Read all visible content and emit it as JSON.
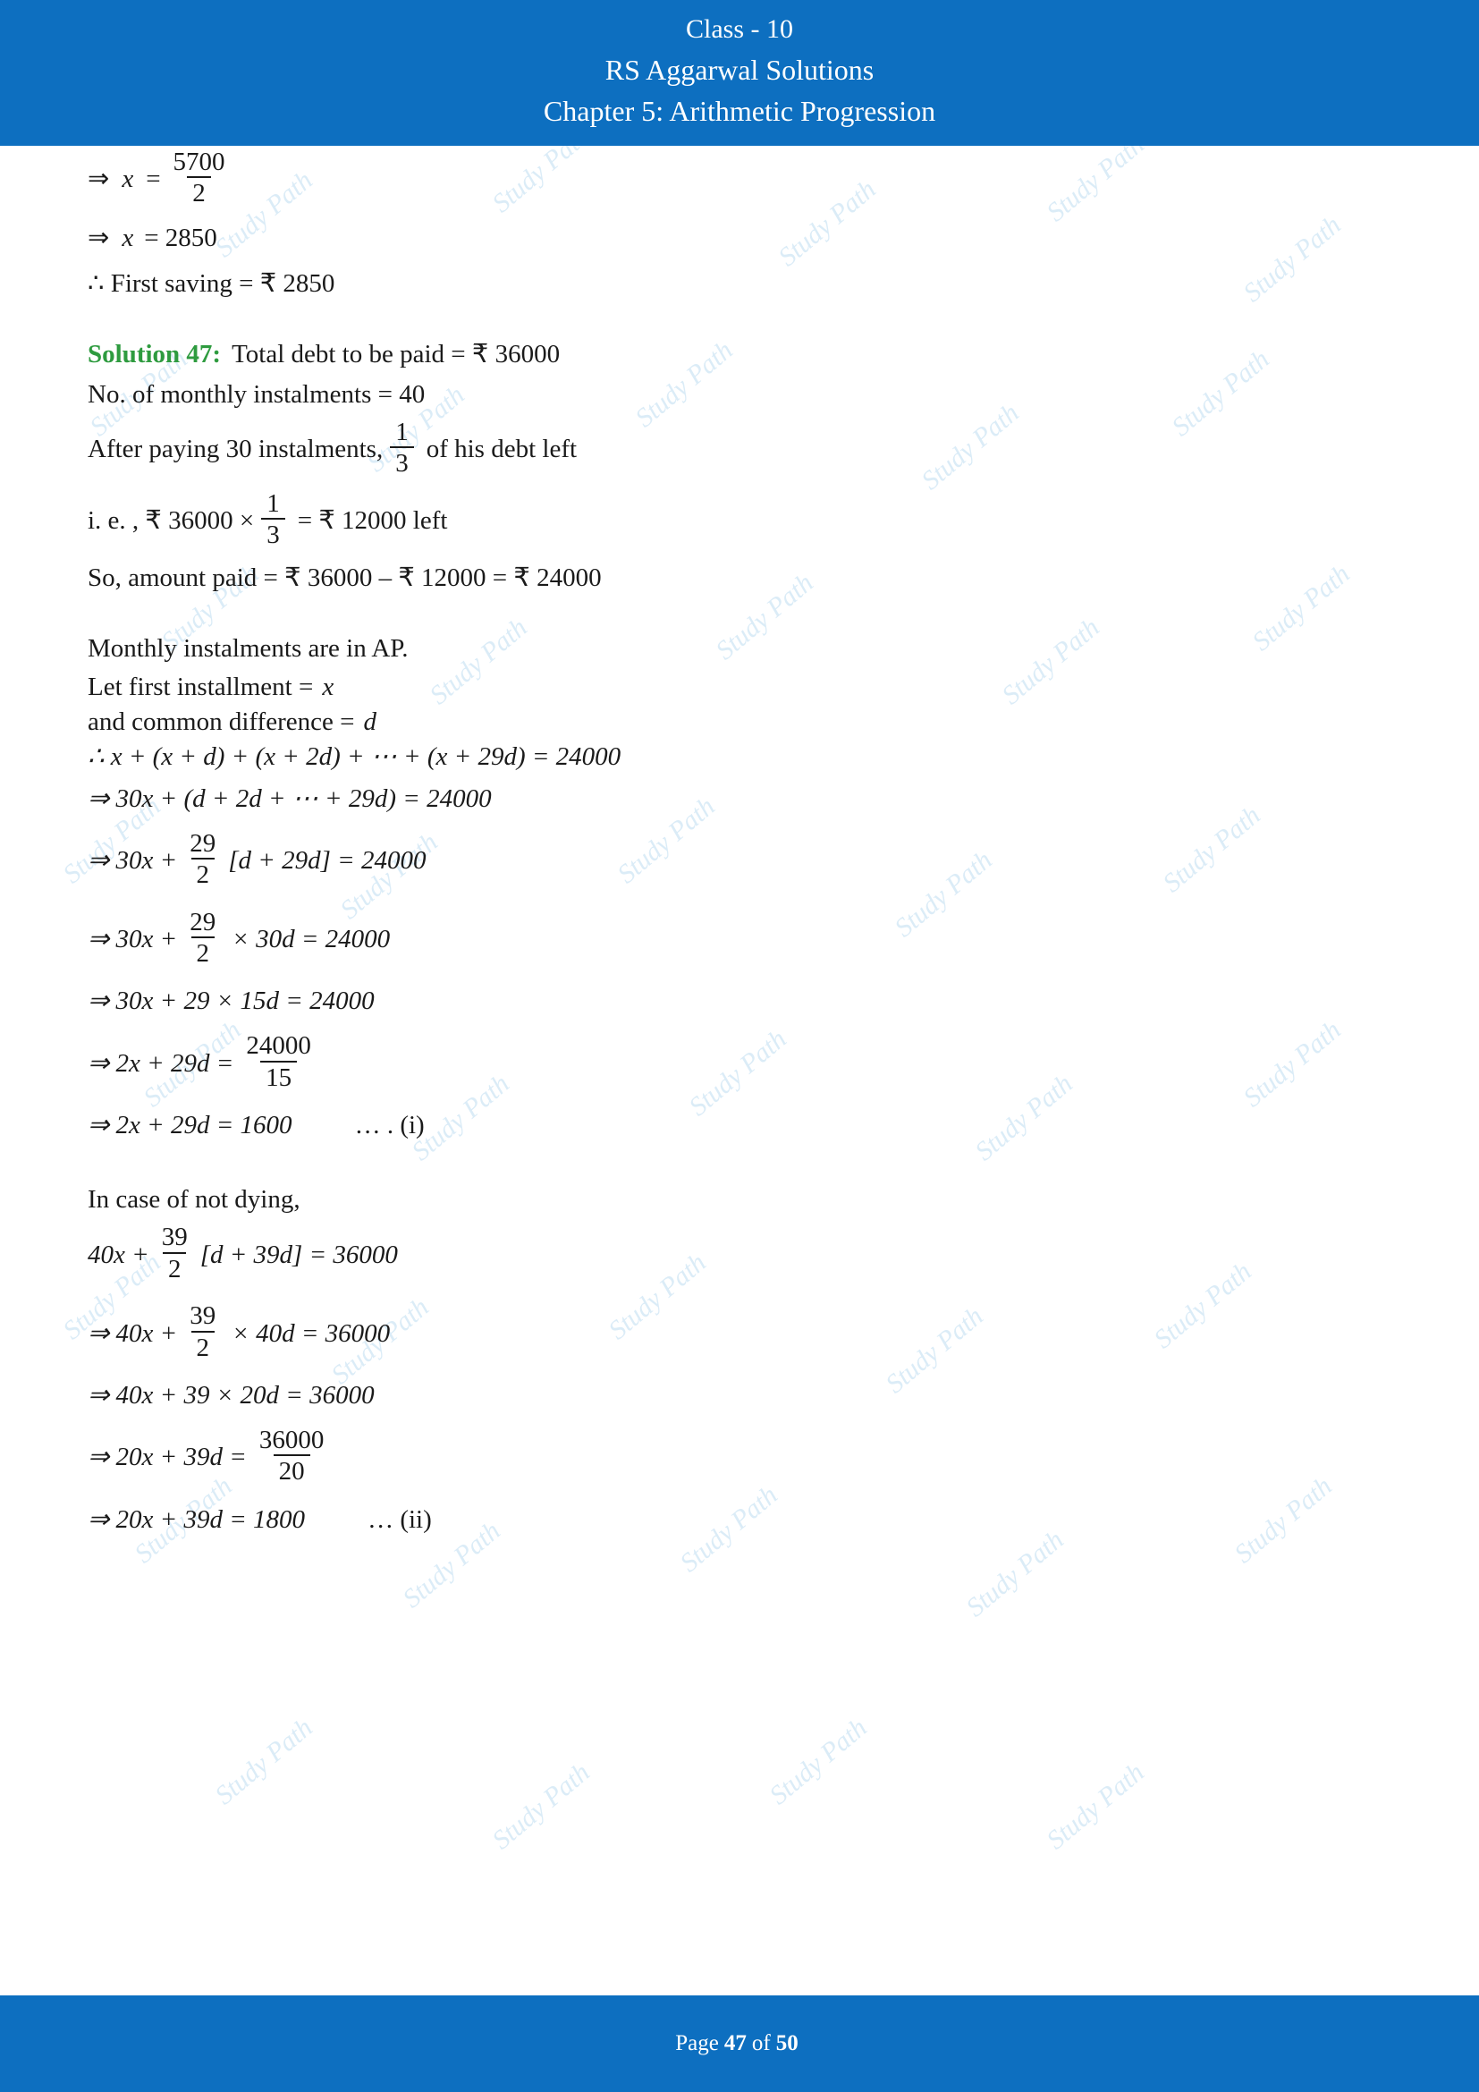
{
  "header": {
    "class_line": "Class - 10",
    "book_line": "RS Aggarwal Solutions",
    "chapter_line": "Chapter 5: Arithmetic Progression"
  },
  "footer": {
    "prefix": "Page",
    "current_page": "47",
    "middle": "of",
    "total_pages": "50"
  },
  "watermark": {
    "text": "Study Path"
  },
  "body": {
    "l1_arrow": "⇒",
    "l1_var": "x",
    "l1_eq": "=",
    "l1_num": "5700",
    "l1_den": "2",
    "l2": "⇒ x = 2850",
    "l2_arrow": "⇒",
    "l2_var": "x",
    "l2_rest": "= 2850",
    "l3": "∴ First saving = ₹ 2850",
    "sol_label": "Solution 47:",
    "sol_text": "Total debt to be paid = ₹ 36000",
    "l5": "No. of monthly instalments = 40",
    "l6_pre": "After paying 30 instalments,",
    "l6_num": "1",
    "l6_den": "3",
    "l6_post": "of his debt left",
    "l7_pre": "i. e. , ₹ 36000 ×",
    "l7_num": "1",
    "l7_den": "3",
    "l7_post": "= ₹ 12000 left",
    "l8": "So, amount paid = ₹ 36000 – ₹ 12000 = ₹ 24000",
    "l9": "Monthly instalments are in AP.",
    "l10_pre": "Let first installment =",
    "l10_var": "x",
    "l11_pre": "and common difference =",
    "l11_var": "d",
    "l12": "∴ x + (x + d) + (x + 2d) + ⋯ + (x + 29d) = 24000",
    "l13": "⇒ 30x + (d + 2d + ⋯ + 29d) = 24000",
    "l14_pre": "⇒ 30x +",
    "l14_num": "29",
    "l14_den": "2",
    "l14_post": "[d + 29d] = 24000",
    "l15_pre": "⇒ 30x +",
    "l15_num": "29",
    "l15_den": "2",
    "l15_post": "× 30d = 24000",
    "l16": "⇒ 30x + 29 × 15d = 24000",
    "l17_pre": "⇒ 2x + 29d =",
    "l17_num": "24000",
    "l17_den": "15",
    "l18_pre": "⇒ 2x + 29d = 1600",
    "l18_ref": "… . (i)",
    "l19": "In case of not dying,",
    "l20_pre": "40x +",
    "l20_num": "39",
    "l20_den": "2",
    "l20_post": "[d + 39d] = 36000",
    "l21_pre": "⇒ 40x +",
    "l21_num": "39",
    "l21_den": "2",
    "l21_post": "× 40d = 36000",
    "l22": "⇒ 40x + 39 × 20d = 36000",
    "l23_pre": "⇒ 20x + 39d =",
    "l23_num": "36000",
    "l23_den": "20",
    "l24_pre": "⇒ 20x + 39d = 1800",
    "l24_ref": "… (ii)"
  }
}
